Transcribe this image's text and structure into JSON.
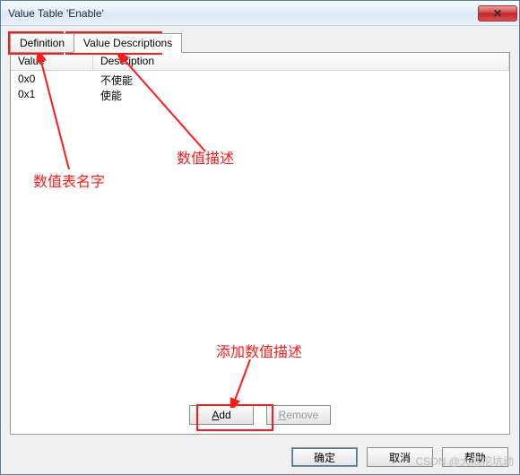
{
  "window": {
    "title": "Value Table 'Enable'",
    "close": "✕"
  },
  "tabs": {
    "definition": "Definition",
    "descriptions": "Value Descriptions"
  },
  "columns": {
    "value": "Value",
    "description": "Description"
  },
  "rows": [
    {
      "value": "0x0",
      "description": "不使能"
    },
    {
      "value": "0x1",
      "description": "使能"
    }
  ],
  "buttons": {
    "add_u": "A",
    "add_rest": "dd",
    "remove_u": "R",
    "remove_rest": "emove",
    "ok": "确定",
    "cancel": "取消",
    "help": "帮助"
  },
  "annotations": {
    "name": "数值表名字",
    "desc": "数值描述",
    "adddesc": "添加数值描述"
  },
  "watermark": "CSDN @大陈挖坑动"
}
